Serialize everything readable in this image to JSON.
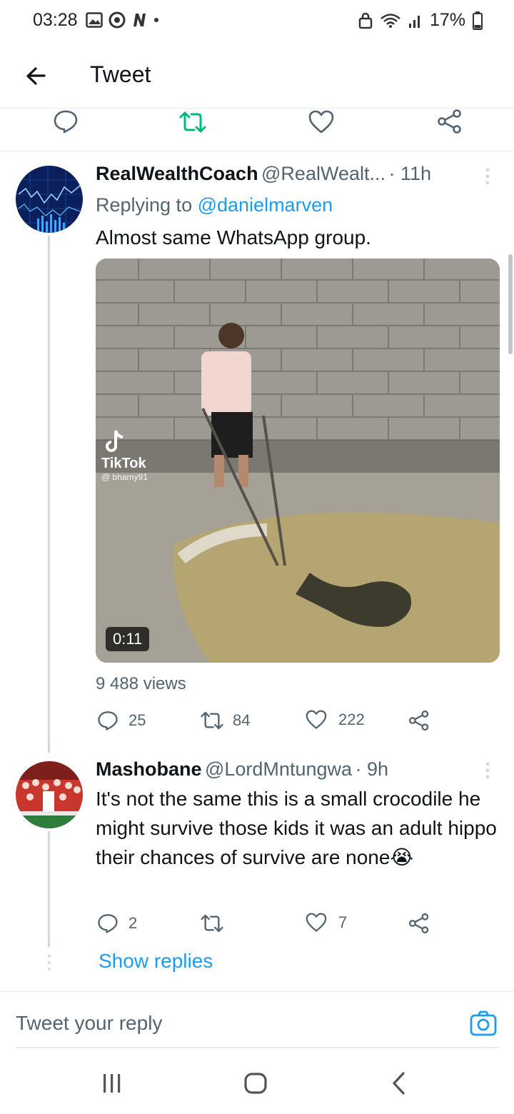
{
  "status_bar": {
    "time": "03:28",
    "battery": "17%"
  },
  "header": {
    "title": "Tweet"
  },
  "replies": [
    {
      "display_name": "RealWealthCoach",
      "handle": "@RealWealt...",
      "time": "· 11h",
      "replying_prefix": "Replying to ",
      "replying_to": "@danielmarven",
      "text": "Almost same WhatsApp group.",
      "media": {
        "duration": "0:11",
        "watermark_name": "TikTok",
        "watermark_user": "@ bhamy91"
      },
      "views": "9 488 views",
      "counts": {
        "reply": "25",
        "retweet": "84",
        "like": "222"
      }
    },
    {
      "display_name": "Mashobane",
      "handle": "@LordMntungwa",
      "time": "· 9h",
      "text": "It's not the same this is a small crocodile he might survive those kids it was an adult hippo their chances of survive are none😭",
      "counts": {
        "reply": "2",
        "retweet": "",
        "like": "7"
      }
    }
  ],
  "show_replies": "Show replies",
  "composer": {
    "placeholder": "Tweet your reply"
  },
  "colors": {
    "accent": "#1d9bf0",
    "retweet_green": "#00ba7c",
    "muted": "#536471"
  }
}
